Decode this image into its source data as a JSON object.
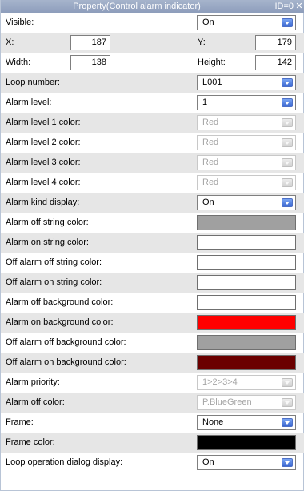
{
  "title": "Property(Control alarm indicator)",
  "id_label": "ID=0",
  "close_glyph": "✕",
  "visible": {
    "label": "Visible:",
    "value": "On"
  },
  "position": {
    "x_label": "X:",
    "x_value": "187",
    "y_label": "Y:",
    "y_value": "179"
  },
  "size": {
    "width_label": "Width:",
    "width_value": "138",
    "height_label": "Height:",
    "height_value": "142"
  },
  "rows": [
    {
      "label": "Loop number:",
      "value": "L001",
      "kind": "combo"
    },
    {
      "label": "Alarm level:",
      "value": "1",
      "kind": "combo"
    },
    {
      "label": "Alarm level 1 color:",
      "value": "Red",
      "kind": "combo-disabled"
    },
    {
      "label": "Alarm level 2 color:",
      "value": "Red",
      "kind": "combo-disabled"
    },
    {
      "label": "Alarm level 3 color:",
      "value": "Red",
      "kind": "combo-disabled"
    },
    {
      "label": "Alarm level 4 color:",
      "value": "Red",
      "kind": "combo-disabled"
    },
    {
      "label": "Alarm kind display:",
      "value": "On",
      "kind": "combo"
    },
    {
      "label": "Alarm off string color:",
      "color": "#a0a0a0",
      "kind": "color"
    },
    {
      "label": "Alarm on string color:",
      "color": "#ffffff",
      "kind": "color"
    },
    {
      "label": "Off alarm off string color:",
      "color": "#ffffff",
      "kind": "color"
    },
    {
      "label": "Off alarm on string color:",
      "color": "#ffffff",
      "kind": "color"
    },
    {
      "label": "Alarm off background color:",
      "color": "#ffffff",
      "kind": "color"
    },
    {
      "label": "Alarm on background color:",
      "color": "#ff0000",
      "kind": "color"
    },
    {
      "label": "Off alarm off background color:",
      "color": "#a0a0a0",
      "kind": "color"
    },
    {
      "label": "Off alarm on background color:",
      "color": "#6b0000",
      "kind": "color"
    },
    {
      "label": "Alarm priority:",
      "value": "1>2>3>4",
      "kind": "combo-disabled"
    },
    {
      "label": "Alarm off color:",
      "value": "P.BlueGreen",
      "kind": "combo-disabled"
    },
    {
      "label": "Frame:",
      "value": "None",
      "kind": "combo"
    },
    {
      "label": "Frame color:",
      "color": "#000000",
      "kind": "color"
    },
    {
      "label": "Loop operation dialog display:",
      "value": "On",
      "kind": "combo"
    }
  ],
  "colors": {
    "title_bar": "#97a6c2",
    "alt_row": "#e6e6e6",
    "dropdown_button": "#3a67d1"
  }
}
